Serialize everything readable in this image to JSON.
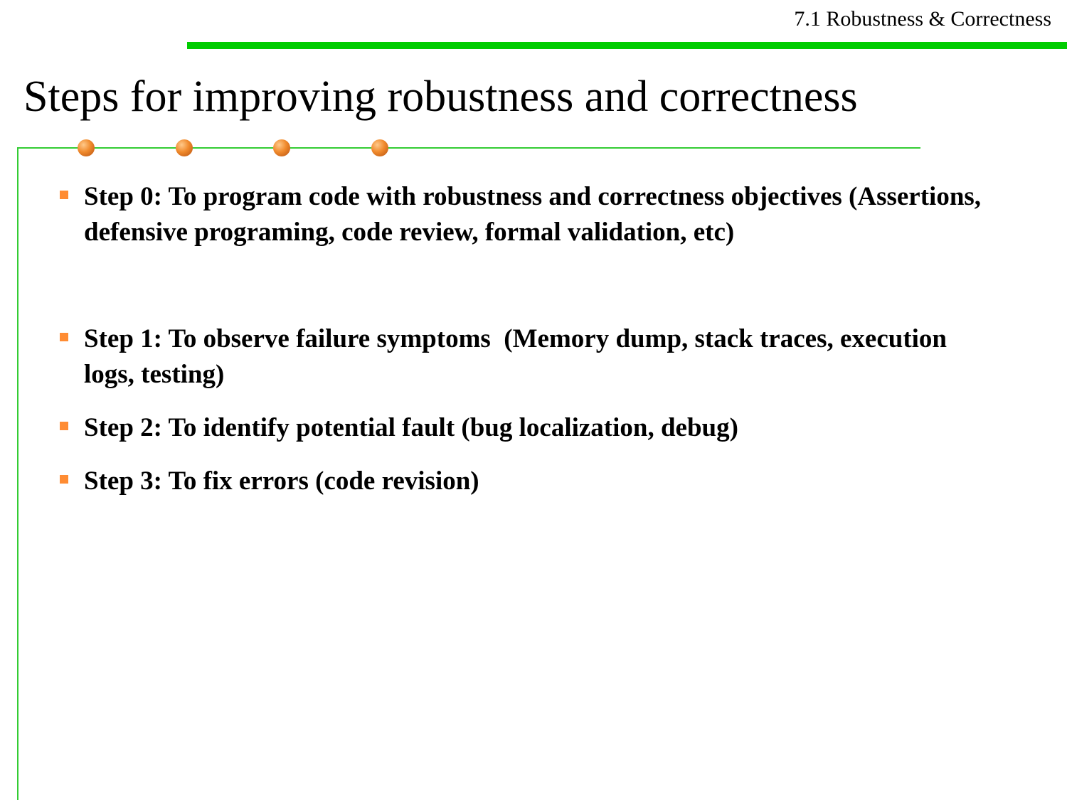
{
  "header": {
    "section_label": "7.1 Robustness & Correctness",
    "accent_color": "#00cc00"
  },
  "slide": {
    "title": "Steps for improving robustness and correctness",
    "bullet_color": "#ff8c33",
    "decoration": "four-orange-dots-icon",
    "bullets": [
      "Step 0: To program code with robustness and correctness objectives (Assertions, defensive programing, code review, formal validation, etc)",
      "Step 1: To observe failure symptoms  (Memory dump, stack traces, execution logs, testing)",
      "Step 2: To identify potential fault (bug localization, debug)",
      "Step 3: To fix errors (code revision)"
    ]
  }
}
